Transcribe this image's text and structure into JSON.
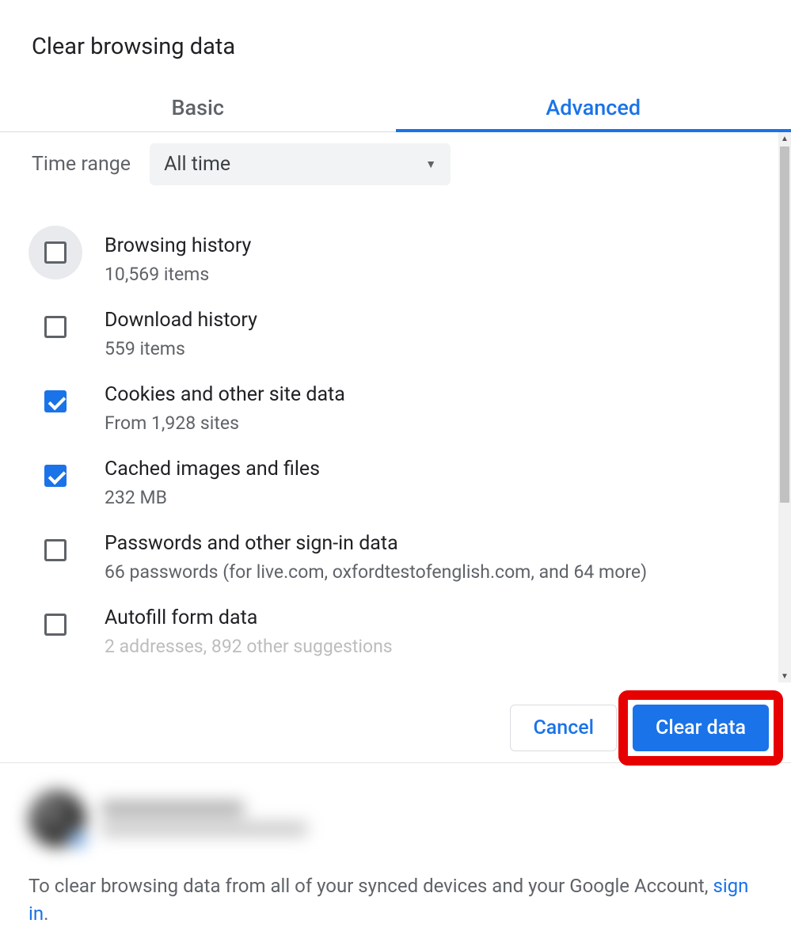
{
  "dialog": {
    "title": "Clear browsing data"
  },
  "tabs": {
    "basic": "Basic",
    "advanced": "Advanced"
  },
  "timerange": {
    "label": "Time range",
    "value": "All time"
  },
  "items": [
    {
      "title": "Browsing history",
      "sub": "10,569 items",
      "checked": false,
      "focused": true
    },
    {
      "title": "Download history",
      "sub": "559 items",
      "checked": false,
      "focused": false
    },
    {
      "title": "Cookies and other site data",
      "sub": "From 1,928 sites",
      "checked": true,
      "focused": false
    },
    {
      "title": "Cached images and files",
      "sub": "232 MB",
      "checked": true,
      "focused": false
    },
    {
      "title": "Passwords and other sign-in data",
      "sub": "66 passwords (for live.com, oxfordtestofenglish.com, and 64 more)",
      "checked": false,
      "focused": false
    },
    {
      "title": "Autofill form data",
      "sub": "2 addresses, 892 other suggestions",
      "checked": false,
      "focused": false
    }
  ],
  "buttons": {
    "cancel": "Cancel",
    "clear": "Clear data"
  },
  "footer": {
    "text_before": "To clear browsing data from all of your synced devices and your Google Account, ",
    "link": "sign in",
    "text_after": "."
  }
}
